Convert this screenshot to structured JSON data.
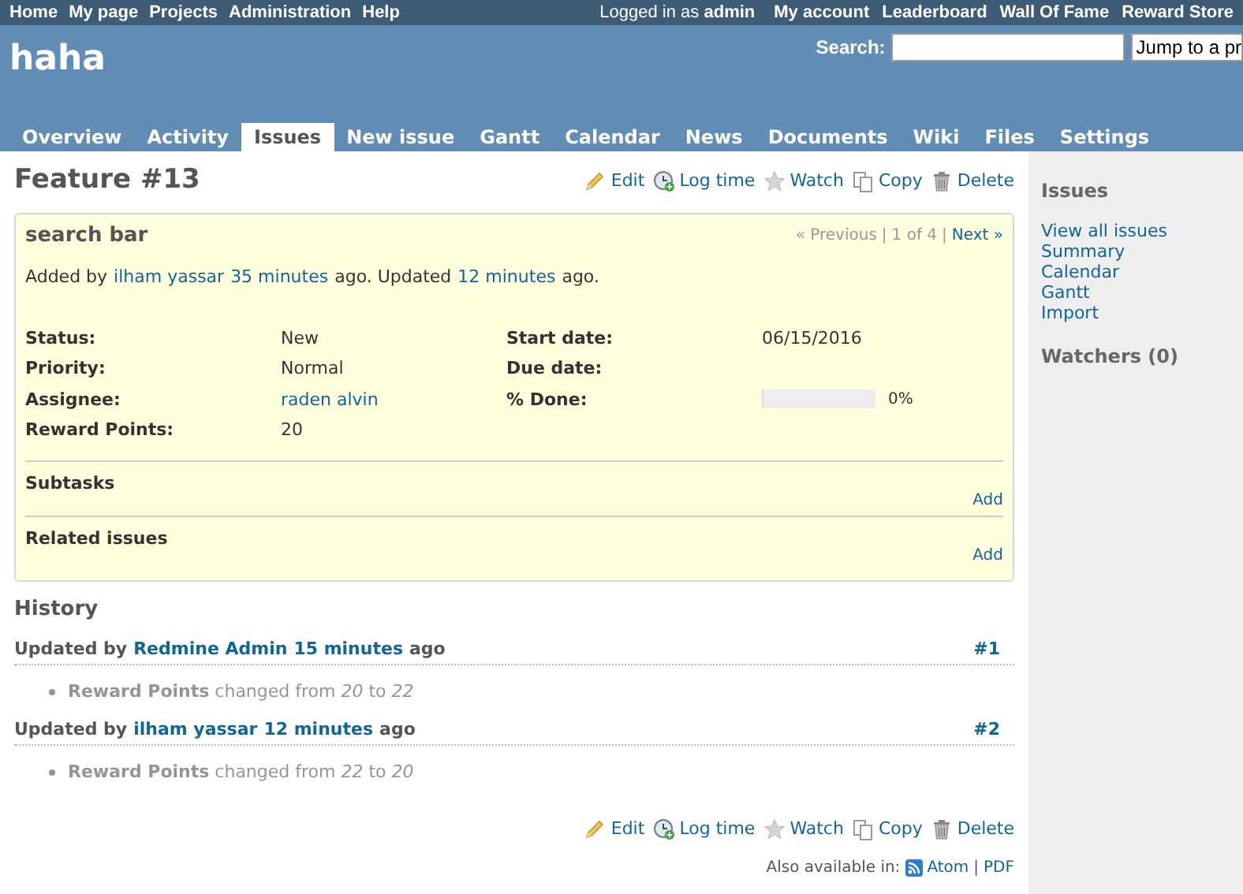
{
  "top_menu": {
    "left": [
      "Home",
      "My page",
      "Projects",
      "Administration",
      "Help"
    ],
    "logged_in_prefix": "Logged in as",
    "logged_in_user": "admin",
    "right": [
      "My account",
      "Leaderboard",
      "Wall Of Fame",
      "Reward Store"
    ]
  },
  "header": {
    "project": "haha",
    "search_label": "Search:",
    "jump": "Jump to a pr"
  },
  "tabs": [
    {
      "label": "Overview",
      "selected": false
    },
    {
      "label": "Activity",
      "selected": false
    },
    {
      "label": "Issues",
      "selected": true
    },
    {
      "label": "New issue",
      "selected": false
    },
    {
      "label": "Gantt",
      "selected": false
    },
    {
      "label": "Calendar",
      "selected": false
    },
    {
      "label": "News",
      "selected": false
    },
    {
      "label": "Documents",
      "selected": false
    },
    {
      "label": "Wiki",
      "selected": false
    },
    {
      "label": "Files",
      "selected": false
    },
    {
      "label": "Settings",
      "selected": false
    }
  ],
  "issue": {
    "title": "Feature #13",
    "actions_top": [
      {
        "kind": "edit",
        "label": "Edit"
      },
      {
        "kind": "log",
        "label": "Log time"
      },
      {
        "kind": "watch",
        "label": "Watch"
      },
      {
        "kind": "copy",
        "label": "Copy"
      },
      {
        "kind": "delete",
        "label": "Delete"
      }
    ],
    "subject": "search bar",
    "nav": {
      "previous": "« Previous",
      "separator": "|",
      "position": "1 of 4",
      "separator_2": "|",
      "next": "Next »"
    },
    "author_line": [
      {
        "kind": "text",
        "text": "Added by"
      },
      {
        "kind": "link",
        "text": "ilham yassar"
      },
      {
        "kind": "link",
        "text": "35 minutes"
      },
      {
        "kind": "text",
        "text": "ago. Updated"
      },
      {
        "kind": "link",
        "text": "12 minutes"
      },
      {
        "kind": "text",
        "text": "ago."
      }
    ],
    "attributes": [
      {
        "label": "Status:",
        "value": "New",
        "kind": "text"
      },
      {
        "label": "Start date:",
        "value": "06/15/2016",
        "kind": "text"
      },
      {
        "label": "Priority:",
        "value": "Normal",
        "kind": "text"
      },
      {
        "label": "Due date:",
        "kind": "text"
      },
      {
        "label": "Assignee:",
        "value": "raden alvin",
        "kind": "link"
      },
      {
        "label": "% Done:",
        "kind": "progress",
        "level": 0,
        "reading": "0%"
      },
      {
        "label": "Reward Points:",
        "value": "20",
        "kind": "text"
      }
    ],
    "sections": [
      {
        "title": "Subtasks",
        "action": "Add"
      },
      {
        "title": "Related issues",
        "action": "Add"
      }
    ]
  },
  "history": {
    "title": "History",
    "journals": [
      {
        "prefix": "Updated by",
        "user": "Redmine Admin",
        "time": "15 minutes",
        "suffix": "ago",
        "number": "#1",
        "detail": "**Reward Points** changed from *20* to *22*"
      },
      {
        "prefix": "Updated by",
        "user": "ilham yassar",
        "time": "12 minutes",
        "suffix": "ago",
        "number": "#2",
        "detail": "**Reward Points** changed from *22* to *20*"
      }
    ]
  },
  "actions_bottom": [
    {
      "kind": "edit",
      "label": "Edit"
    },
    {
      "kind": "log",
      "label": "Log time"
    },
    {
      "kind": "watch",
      "label": "Watch"
    },
    {
      "kind": "copy",
      "label": "Copy"
    },
    {
      "kind": "delete",
      "label": "Delete"
    }
  ],
  "formats": {
    "label": "Also available in:",
    "separator": "|",
    "links": [
      {
        "kind": "atom",
        "label": "Atom"
      },
      {
        "kind": "pdf",
        "label": "PDF"
      }
    ]
  },
  "sidebar": {
    "title": "Issues",
    "links": [
      "View all issues",
      "Summary",
      "Calendar",
      "Gantt",
      "Import"
    ],
    "watchers": "Watchers (0)"
  }
}
